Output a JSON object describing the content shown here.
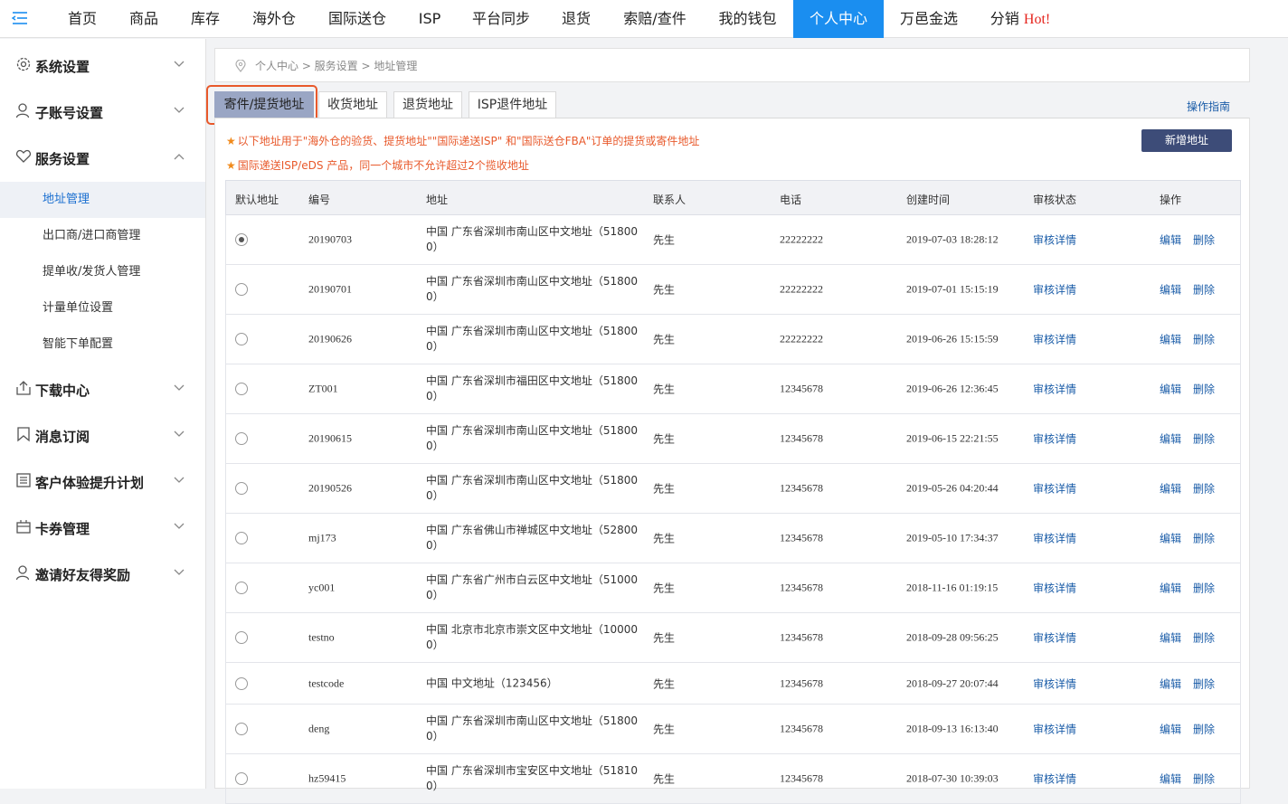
{
  "topnav": {
    "items": [
      "首页",
      "商品",
      "库存",
      "海外仓",
      "国际送仓",
      "ISP",
      "平台同步",
      "退货",
      "索赔/查件",
      "我的钱包",
      "个人中心",
      "万邑金选",
      "分销"
    ],
    "hot_label": "Hot!",
    "active": "个人中心",
    "accent_color": "#1a8ef0"
  },
  "sidebar": {
    "groups": [
      {
        "label": "系统设置",
        "icon": "gear-icon"
      },
      {
        "label": "子账号设置",
        "icon": "user-icon"
      },
      {
        "label": "服务设置",
        "icon": "heart-icon",
        "expanded": true
      },
      {
        "label": "下载中心",
        "icon": "download-icon"
      },
      {
        "label": "消息订阅",
        "icon": "bookmark-icon"
      },
      {
        "label": "客户体验提升计划",
        "icon": "list-icon"
      },
      {
        "label": "卡券管理",
        "icon": "ticket-icon"
      },
      {
        "label": "邀请好友得奖励",
        "icon": "user-icon"
      }
    ],
    "sub_items": [
      "地址管理",
      "出口商/进口商管理",
      "提单收/发货人管理",
      "计量单位设置",
      "智能下单配置"
    ],
    "active_sub": "地址管理"
  },
  "breadcrumb": "个人中心 > 服务设置 > 地址管理",
  "tabs": [
    "寄件/提货地址",
    "收货地址",
    "退货地址",
    "ISP退件地址"
  ],
  "active_tab": "寄件/提货地址",
  "guide_link": "操作指南",
  "notices": [
    "以下地址用于\"海外仓的验货、提货地址\"\"国际递送ISP\" 和\"国际送仓FBA\"订单的提货或寄件地址",
    "国际递送ISP/eDS 产品，同一个城市不允许超过2个揽收地址"
  ],
  "add_button": "新增地址",
  "table": {
    "headers": [
      "默认地址",
      "编号",
      "地址",
      "联系人",
      "电话",
      "创建时间",
      "审核状态",
      "操作"
    ],
    "detail_label": "审核详情",
    "edit_label": "编辑",
    "delete_label": "删除",
    "rows": [
      {
        "default": true,
        "code": "20190703",
        "addr1": "中国 广东省深圳市南山区中文地址（51800",
        "addr2": "0）",
        "contact": "先生",
        "phone": "22222222",
        "created": "2019-07-03 18:28:12"
      },
      {
        "default": false,
        "code": "20190701",
        "addr1": "中国 广东省深圳市南山区中文地址（51800",
        "addr2": "0）",
        "contact": "先生",
        "phone": "22222222",
        "created": "2019-07-01 15:15:19"
      },
      {
        "default": false,
        "code": "20190626",
        "addr1": "中国 广东省深圳市南山区中文地址（51800",
        "addr2": "0）",
        "contact": "先生",
        "phone": "22222222",
        "created": "2019-06-26 15:15:59"
      },
      {
        "default": false,
        "code": "ZT001",
        "addr1": "中国 广东省深圳市福田区中文地址（51800",
        "addr2": "0）",
        "contact": "先生",
        "phone": "12345678",
        "created": "2019-06-26 12:36:45"
      },
      {
        "default": false,
        "code": "20190615",
        "addr1": "中国 广东省深圳市南山区中文地址（51800",
        "addr2": "0）",
        "contact": "先生",
        "phone": "12345678",
        "created": "2019-06-15 22:21:55"
      },
      {
        "default": false,
        "code": "20190526",
        "addr1": "中国 广东省深圳市南山区中文地址（51800",
        "addr2": "0）",
        "contact": "先生",
        "phone": "12345678",
        "created": "2019-05-26 04:20:44"
      },
      {
        "default": false,
        "code": "mj173",
        "addr1": "中国 广东省佛山市禅城区中文地址（52800",
        "addr2": "0）",
        "contact": "先生",
        "phone": "12345678",
        "created": "2019-05-10 17:34:37"
      },
      {
        "default": false,
        "code": "yc001",
        "addr1": "中国 广东省广州市白云区中文地址（51000",
        "addr2": "0）",
        "contact": "先生",
        "phone": "12345678",
        "created": "2018-11-16 01:19:15"
      },
      {
        "default": false,
        "code": "testno",
        "addr1": "中国 北京市北京市崇文区中文地址（10000",
        "addr2": "0）",
        "contact": "先生",
        "phone": "12345678",
        "created": "2018-09-28 09:56:25"
      },
      {
        "default": false,
        "code": "testcode",
        "addr1": "中国 中文地址（123456）",
        "addr2": "",
        "contact": "先生",
        "phone": "12345678",
        "created": "2018-09-27 20:07:44"
      },
      {
        "default": false,
        "code": "deng",
        "addr1": "中国 广东省深圳市南山区中文地址（51800",
        "addr2": "0）",
        "contact": "先生",
        "phone": "12345678",
        "created": "2018-09-13 16:13:40"
      },
      {
        "default": false,
        "code": "hz59415",
        "addr1": "中国 广东省深圳市宝安区中文地址（51810",
        "addr2": "0）",
        "contact": "先生",
        "phone": "12345678",
        "created": "2018-07-30 10:39:03"
      }
    ]
  }
}
